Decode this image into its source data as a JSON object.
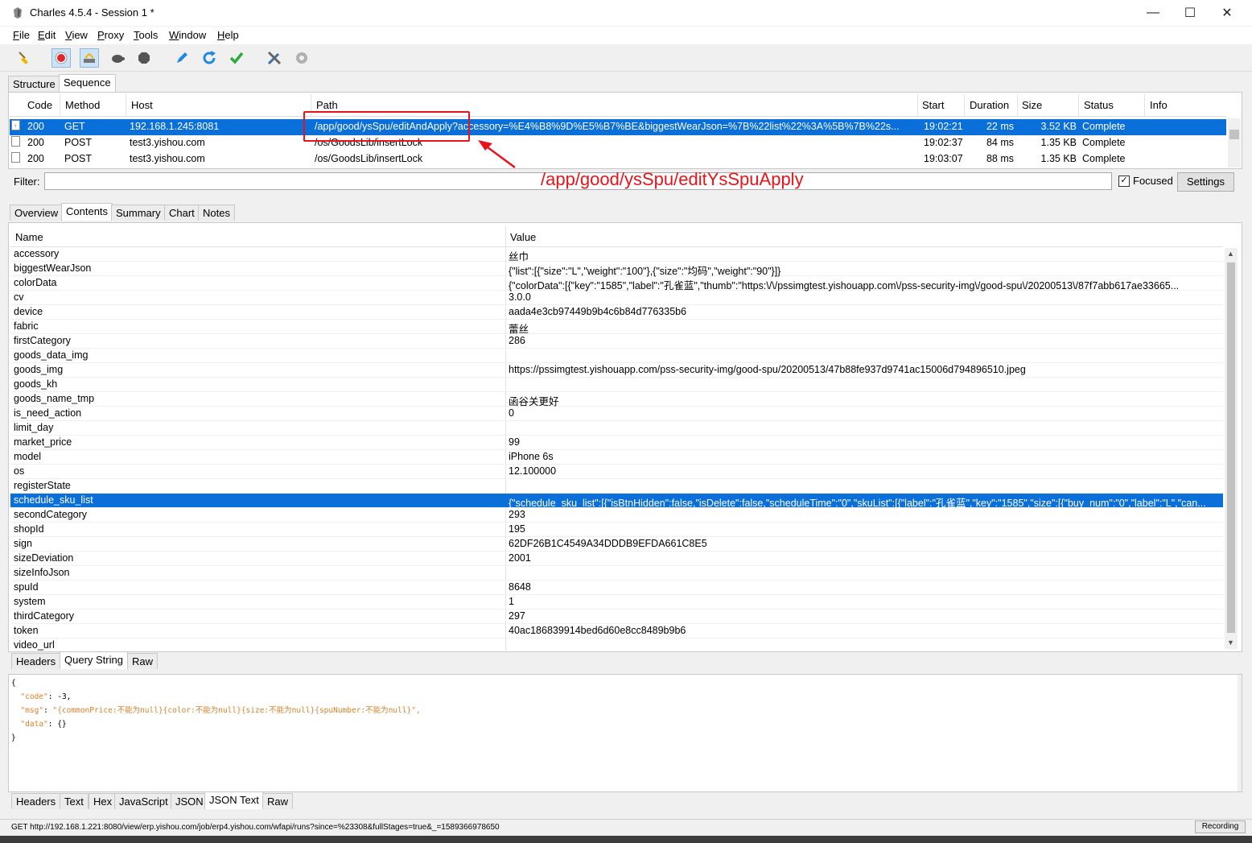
{
  "window": {
    "title": "Charles 4.5.4 - Session 1 *",
    "controls": {
      "minimize": "—",
      "maximize": "☐",
      "close": "✕"
    }
  },
  "menu": [
    {
      "mnemonic": "F",
      "rest": "ile"
    },
    {
      "mnemonic": "E",
      "rest": "dit"
    },
    {
      "mnemonic": "V",
      "rest": "iew"
    },
    {
      "mnemonic": "P",
      "rest": "roxy"
    },
    {
      "mnemonic": "T",
      "rest": "ools"
    },
    {
      "mnemonic": "W",
      "rest": "indow"
    },
    {
      "mnemonic": "H",
      "rest": "elp"
    }
  ],
  "toolbar": {
    "icons": [
      "broom-icon",
      "record-icon",
      "throttle-icon",
      "turtle-icon",
      "stop-icon",
      "pen-icon",
      "refresh-icon",
      "check-icon",
      "tools-icon",
      "gear-icon"
    ],
    "colors": {
      "record": "#e0282e",
      "refresh": "#1e88e5",
      "check": "#2eaa3c"
    }
  },
  "view_tabs": {
    "structure": "Structure",
    "sequence": "Sequence"
  },
  "sequence": {
    "columns": [
      "Code",
      "Method",
      "Host",
      "Path",
      "Start",
      "Duration",
      "Size",
      "Status",
      "Info"
    ],
    "rows": [
      {
        "code": "200",
        "method": "GET",
        "host": "192.168.1.245:8081",
        "path": "/app/good/ysSpu/editAndApply?accessory=%E4%B8%9D%E5%B7%BE&biggestWearJson=%7B%22list%22%3A%5B%7B%22s...",
        "start": "19:02:21",
        "duration": "22 ms",
        "size": "3.52 KB",
        "status": "Complete",
        "info": ""
      },
      {
        "code": "200",
        "method": "POST",
        "host": "test3.yishou.com",
        "path": "/os/GoodsLib/insertLock",
        "start": "19:02:37",
        "duration": "84 ms",
        "size": "1.35 KB",
        "status": "Complete",
        "info": ""
      },
      {
        "code": "200",
        "method": "POST",
        "host": "test3.yishou.com",
        "path": "/os/GoodsLib/insertLock",
        "start": "19:03:07",
        "duration": "88 ms",
        "size": "1.35 KB",
        "status": "Complete",
        "info": ""
      }
    ]
  },
  "filter": {
    "label": "Filter:",
    "value": "",
    "focused_label": "Focused",
    "settings_label": "Settings"
  },
  "annotation": {
    "text": "/app/good/ysSpu/editYsSpuApply",
    "color": "#e8141a"
  },
  "detail_tabs": [
    "Overview",
    "Contents",
    "Summary",
    "Chart",
    "Notes"
  ],
  "params": {
    "columns": [
      "Name",
      "Value"
    ],
    "rows": [
      {
        "name": "accessory",
        "value": "丝巾"
      },
      {
        "name": "biggestWearJson",
        "value": "{\"list\":[{\"size\":\"L\",\"weight\":\"100\"},{\"size\":\"均码\",\"weight\":\"90\"}]}"
      },
      {
        "name": "colorData",
        "value": "{\"colorData\":[{\"key\":\"1585\",\"label\":\"孔雀蓝\",\"thumb\":\"https:\\/\\/pssimgtest.yishouapp.com\\/pss-security-img\\/good-spu\\/20200513\\/87f7abb617ae33665..."
      },
      {
        "name": "cv",
        "value": "3.0.0"
      },
      {
        "name": "device",
        "value": "aada4e3cb97449b9b4c6b84d776335b6"
      },
      {
        "name": "fabric",
        "value": "蕾丝"
      },
      {
        "name": "firstCategory",
        "value": "286"
      },
      {
        "name": "goods_data_img",
        "value": ""
      },
      {
        "name": "goods_img",
        "value": "https://pssimgtest.yishouapp.com/pss-security-img/good-spu/20200513/47b88fe937d9741ac15006d794896510.jpeg"
      },
      {
        "name": "goods_kh",
        "value": ""
      },
      {
        "name": "goods_name_tmp",
        "value": "函谷关更好"
      },
      {
        "name": "is_need_action",
        "value": "0"
      },
      {
        "name": "limit_day",
        "value": ""
      },
      {
        "name": "market_price",
        "value": "99"
      },
      {
        "name": "model",
        "value": "iPhone 6s"
      },
      {
        "name": "os",
        "value": "12.100000"
      },
      {
        "name": "registerState",
        "value": ""
      },
      {
        "name": "schedule_sku_list",
        "value": "{\"schedule_sku_list\":[{\"isBtnHidden\":false,\"isDelete\":false,\"scheduleTime\":\"0\",\"skuList\":[{\"label\":\"孔雀蓝\",\"key\":\"1585\",\"size\":[{\"buy_num\":\"0\",\"label\":\"L\",\"can..."
      },
      {
        "name": "secondCategory",
        "value": "293"
      },
      {
        "name": "shopId",
        "value": "195"
      },
      {
        "name": "sign",
        "value": "62DF26B1C4549A34DDDB9EFDA661C8E5"
      },
      {
        "name": "sizeDeviation",
        "value": "2001"
      },
      {
        "name": "sizeInfoJson",
        "value": ""
      },
      {
        "name": "spuId",
        "value": "8648"
      },
      {
        "name": "system",
        "value": "1"
      },
      {
        "name": "thirdCategory",
        "value": "297"
      },
      {
        "name": "token",
        "value": "40ac186839914bed6d60e8cc8489b9b6"
      },
      {
        "name": "video_url",
        "value": ""
      }
    ]
  },
  "request_tabs": [
    "Headers",
    "Query String",
    "Raw"
  ],
  "response_json": {
    "open": "{",
    "l1_key": "\"code\"",
    "l1_sep": ": ",
    "l1_val": "-3,",
    "l2_key": "\"msg\"",
    "l2_sep": ": ",
    "l2_val": "\"{commonPrice:不能为null}{color:不能为null}{size:不能为null}{spuNumber:不能为null}\",",
    "l3_key": "\"data\"",
    "l3_sep": ": ",
    "l3_val": "{}",
    "close": "}"
  },
  "response_tabs": [
    "Headers",
    "Text",
    "Hex",
    "JavaScript",
    "JSON",
    "JSON Text",
    "Raw"
  ],
  "statusbar": {
    "text": "GET http://192.168.1.221:8080/view/erp.yishou.com/job/erp4.yishou.com/wfapi/runs?since=%23308&fullStages=true&_=1589366978650",
    "recording": "Recording"
  }
}
